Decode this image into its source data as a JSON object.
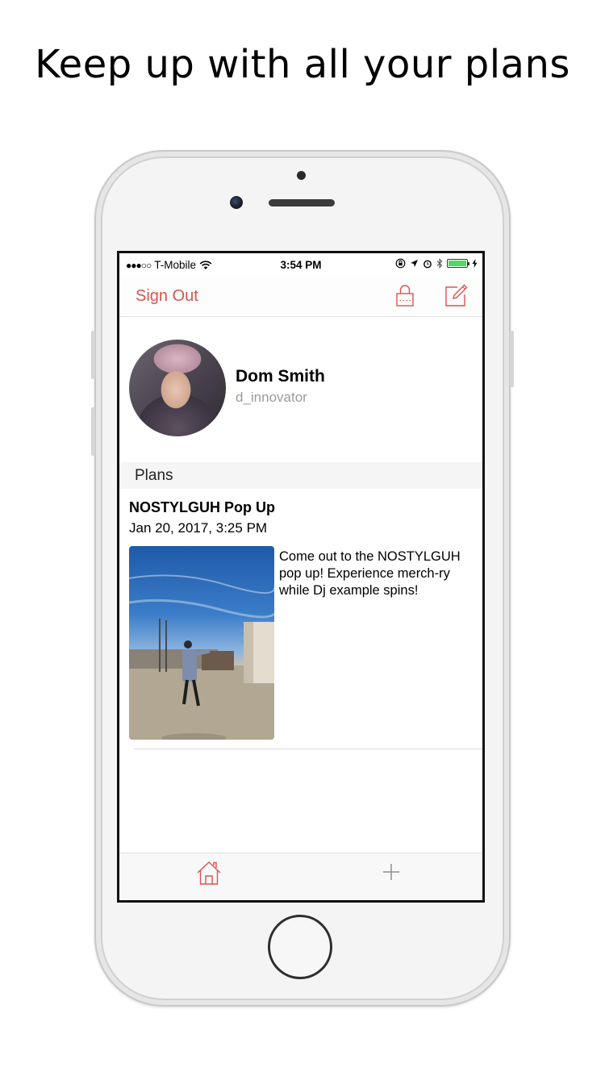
{
  "headline": "Keep up with all your plans",
  "status_bar": {
    "signal_dots": "●●●○○",
    "carrier": "T-Mobile",
    "time": "3:54 PM"
  },
  "nav": {
    "sign_out_label": "Sign Out",
    "lock_icon": "lock-icon",
    "compose_icon": "compose-icon"
  },
  "profile": {
    "name": "Dom Smith",
    "handle": "d_innovator"
  },
  "plans_section": {
    "header": "Plans",
    "items": [
      {
        "title": "NOSTYLGUH Pop Up",
        "date": "Jan 20, 2017, 3:25 PM",
        "description": "Come out to the NOSTYLGUH pop up! Experience merch-ry while Dj example spins!"
      }
    ]
  },
  "tab_bar": {
    "home_icon": "home-icon",
    "add_icon": "plus-icon"
  },
  "colors": {
    "accent": "#d9534f",
    "battery": "#4cd964"
  }
}
